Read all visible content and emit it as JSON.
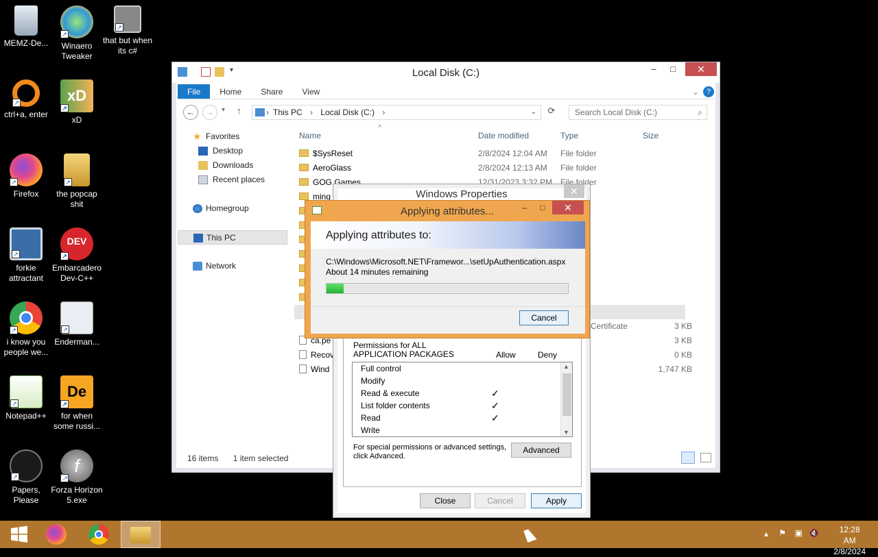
{
  "desktop": {
    "icons": [
      {
        "label": "MEMZ-De..."
      },
      {
        "label": "Winaero Tweaker"
      },
      {
        "label": "that but when its c#"
      },
      {
        "label": "ctrl+a, enter"
      },
      {
        "label": "xD"
      },
      {
        "label": "Firefox"
      },
      {
        "label": "the popcap shit"
      },
      {
        "label": "forkie attractant"
      },
      {
        "label": "Embarcadero Dev-C++"
      },
      {
        "label": "i know you people we..."
      },
      {
        "label": "Enderman..."
      },
      {
        "label": "Notepad++"
      },
      {
        "label": "for when some russi..."
      },
      {
        "label": "Papers, Please"
      },
      {
        "label": "Forza Horizon 5.exe"
      }
    ]
  },
  "explorer": {
    "title": "Local Disk (C:)",
    "tabs": [
      "File",
      "Home",
      "Share",
      "View"
    ],
    "breadcrumb": [
      "This PC",
      "Local Disk (C:)"
    ],
    "search_placeholder": "Search Local Disk (C:)",
    "nav": {
      "favorites": "Favorites",
      "desktop": "Desktop",
      "downloads": "Downloads",
      "recent": "Recent places",
      "homegroup": "Homegroup",
      "thispc": "This PC",
      "network": "Network"
    },
    "columns": {
      "name": "Name",
      "date": "Date modified",
      "type": "Type",
      "size": "Size"
    },
    "rows": [
      {
        "name": "$SysReset",
        "date": "2/8/2024 12:04 AM",
        "type": "File folder",
        "size": ""
      },
      {
        "name": "AeroGlass",
        "date": "2/8/2024 12:13 AM",
        "type": "File folder",
        "size": ""
      },
      {
        "name": "GOG Games",
        "date": "12/31/2023 3:32 PM",
        "type": "File folder",
        "size": ""
      },
      {
        "name": "ming",
        "date": "",
        "type": "",
        "size": ""
      },
      {
        "name": "",
        "date": "",
        "type": "Certificate",
        "size": "3 KB"
      },
      {
        "name": "ca.pe",
        "date": "",
        "type": "",
        "size": "3 KB"
      },
      {
        "name": "Recov",
        "date": "",
        "type": "",
        "size": "0 KB"
      },
      {
        "name": "Wind",
        "date": "",
        "type": "",
        "size": "1,747 KB"
      }
    ],
    "status_items": "16 items",
    "status_selected": "1 item selected"
  },
  "properties": {
    "title": "Windows Properties",
    "perm_header_line1": "Permissions for ALL",
    "perm_header_line2": "APPLICATION PACKAGES",
    "allow": "Allow",
    "deny": "Deny",
    "perms": [
      {
        "name": "Full control",
        "allow": ""
      },
      {
        "name": "Modify",
        "allow": ""
      },
      {
        "name": "Read & execute",
        "allow": "✓"
      },
      {
        "name": "List folder contents",
        "allow": "✓"
      },
      {
        "name": "Read",
        "allow": "✓"
      },
      {
        "name": "Write",
        "allow": ""
      }
    ],
    "special_line1": "For special permissions or advanced settings,",
    "special_line2": "click Advanced.",
    "advanced": "Advanced",
    "close": "Close",
    "cancel": "Cancel",
    "apply": "Apply"
  },
  "apply_dialog": {
    "title": "Applying attributes...",
    "header": "Applying attributes to:",
    "path": "C:\\Windows\\Microsoft.NET\\Framewor...\\setUpAuthentication.aspx",
    "remaining": "About 14 minutes remaining",
    "progress": 0.07,
    "cancel": "Cancel"
  },
  "taskbar": {
    "time": "12:28 AM",
    "date": "2/8/2024"
  }
}
